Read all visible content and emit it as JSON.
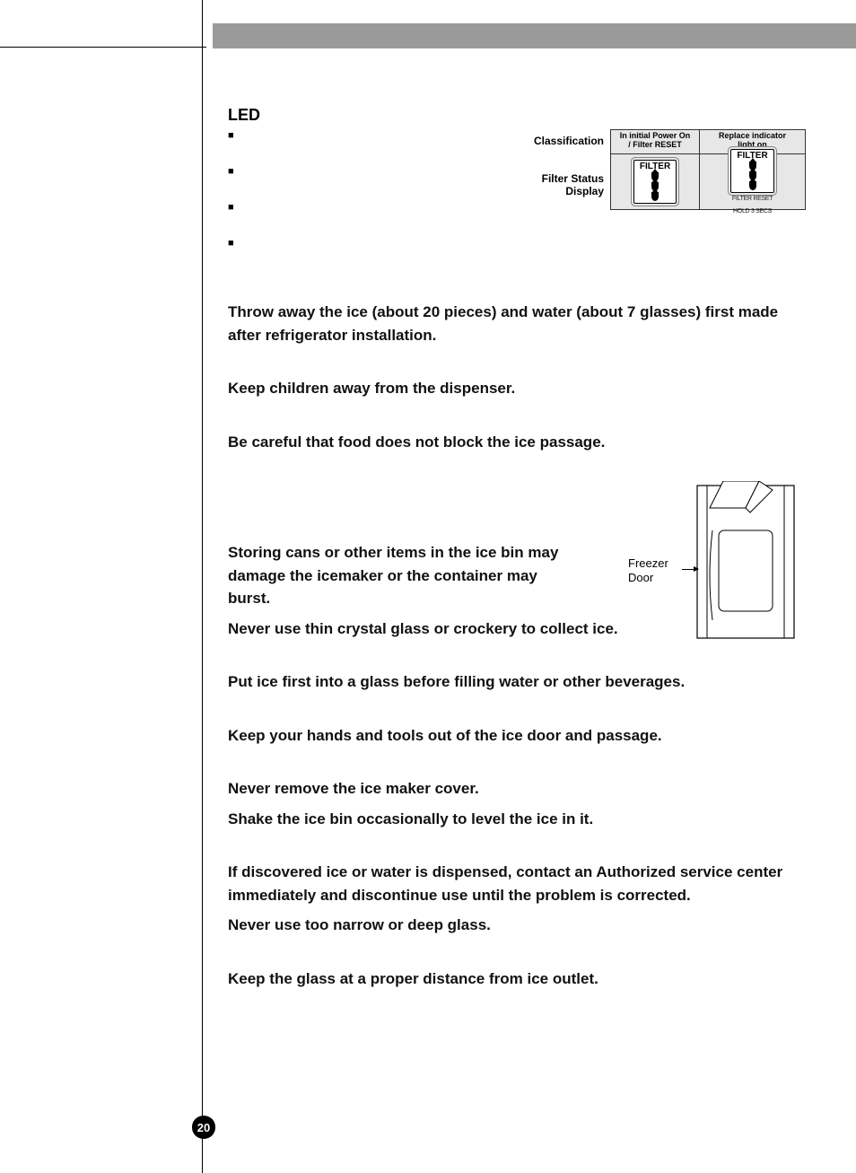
{
  "page_number": "20",
  "section_title": "LED",
  "table": {
    "classification_label": "Classification",
    "filter_status_label_1": "Filter Status",
    "filter_status_label_2": "Display",
    "col1_header_line1": "In initial Power On",
    "col1_header_line2": "/ Filter RESET",
    "col2_header_line1": "Replace indicator",
    "col2_header_line2": "light on",
    "chip_label": "FILTER",
    "reset_line1": "FILTER RESET",
    "reset_line2": "HOLD 3 SECS"
  },
  "freezer_label_line1": "Freezer",
  "freezer_label_line2": "Door",
  "bullets": [
    "■",
    "■",
    "■",
    "■"
  ],
  "paragraphs": {
    "p1": "Throw away the ice (about 20 pieces) and water (about 7 glasses) first made after refrigerator installation.",
    "p2": "Keep children away from the dispenser.",
    "p3": "Be careful that food does not block the ice passage.",
    "p4": "Storing cans or other items in the ice bin may damage the icemaker or the container may burst.",
    "p5": "Never use thin crystal glass or crockery to collect ice.",
    "p6": "Put ice first into a glass before filling water or other beverages.",
    "p7": "Keep your hands and tools out of the ice door and passage.",
    "p8": "Never remove the ice maker cover.",
    "p9": "Shake the ice bin occasionally to level the ice in it.",
    "p10": "If discovered ice or water is dispensed, contact an Authorized service center immediately and discontinue use until the problem is corrected.",
    "p11": "Never use too narrow or deep glass.",
    "p12": "Keep the glass at a proper distance from ice outlet."
  }
}
